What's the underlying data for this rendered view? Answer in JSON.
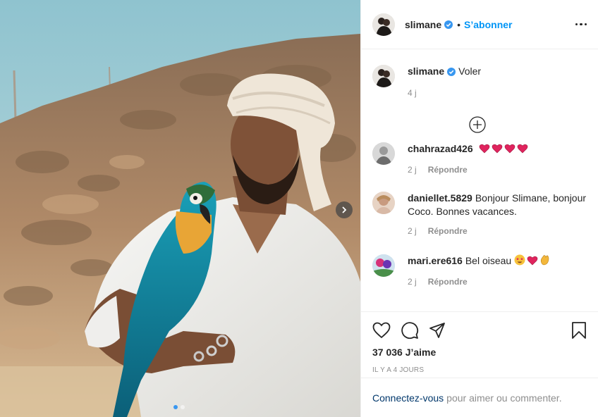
{
  "header": {
    "username": "slimane",
    "separator": "•",
    "follow_label": "S’abonner"
  },
  "caption": {
    "username": "slimane",
    "text": "Voler",
    "time": "4 j"
  },
  "comments": [
    {
      "username": "chahrazad426",
      "text": "",
      "emojis": [
        "heart",
        "heart",
        "heart",
        "heart"
      ],
      "time": "2 j",
      "reply_label": "Répondre"
    },
    {
      "username": "daniellet.5829",
      "text": "Bonjour Slimane, bonjour Coco. Bonnes vacances.",
      "emojis": [],
      "time": "2 j",
      "reply_label": "Répondre"
    },
    {
      "username": "mari.ere616",
      "text": "Bel oiseau",
      "emojis": [
        "star-struck",
        "heart",
        "clapping-hands"
      ],
      "time": "2 j",
      "reply_label": "Répondre"
    }
  ],
  "actions": {
    "likes": "37 036 J’aime",
    "posted": "Il y a 4 jours"
  },
  "login": {
    "link_label": "Connectez-vous",
    "text": "pour aimer ou commenter."
  },
  "carousel": {
    "slides": 2,
    "current": 1
  },
  "colors": {
    "accent": "#0095f6",
    "verified": "#3897f0",
    "text": "#262626",
    "muted": "#8e8e8e",
    "heart": "#e0245e"
  }
}
